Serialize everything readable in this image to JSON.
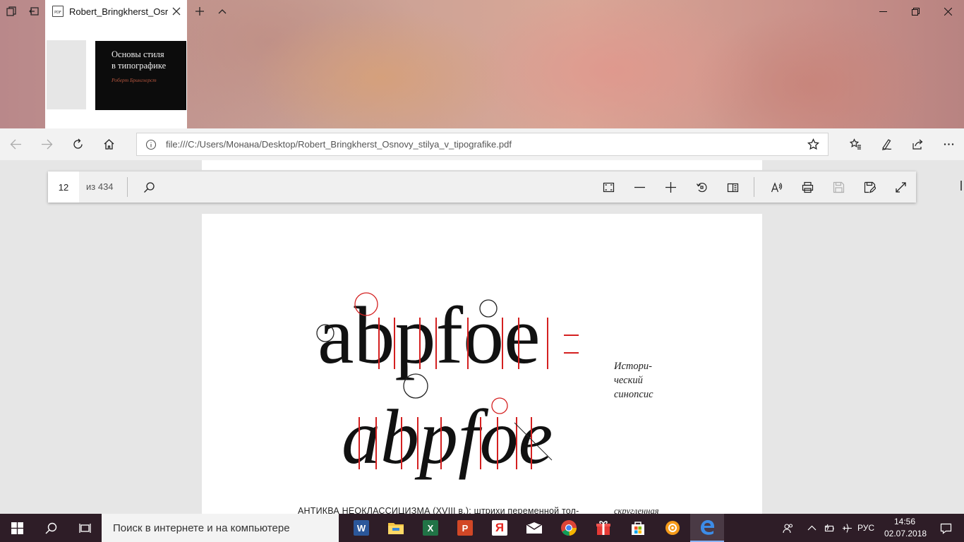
{
  "tab": {
    "title": "Robert_Bringkherst_Osr",
    "favicon_label": "PDF",
    "preview": {
      "book_title_line1": "Основы стиля",
      "book_title_line2": "в типографике",
      "book_author": "Роберт Брингхерст"
    }
  },
  "nav": {
    "url": "file:///C:/Users/Монана/Desktop/Robert_Bringkherst_Osnovy_stilya_v_tipografike.pdf"
  },
  "pdf_toolbar": {
    "page_number": "12",
    "page_total": "из 434",
    "buttons": [
      "fit-page",
      "zoom-out",
      "zoom-in",
      "rotate",
      "layout",
      "read-aloud",
      "print",
      "save",
      "save-as",
      "fullscreen"
    ]
  },
  "page": {
    "figure_top_letters": "abpfoe",
    "figure_bottom_letters": "abpfoe",
    "side_note_line1": "Истори-",
    "side_note_line2": "ческий",
    "side_note_line3": "синопсис",
    "caption": "АНТИКВА НЕОКЛАССИЦИЗМА (XVIII в.): штрихи переменной тол-",
    "caption_side": "скругленная",
    "accent_color": "#d42020"
  },
  "taskbar": {
    "search_placeholder": "Поиск в интернете и на компьютере",
    "language": "РУС",
    "time": "14:56",
    "date": "02.07.2018",
    "apps": [
      "word",
      "file-explorer",
      "excel",
      "powerpoint",
      "yandex",
      "mail",
      "chrome",
      "gift",
      "store",
      "settings",
      "edge"
    ]
  }
}
